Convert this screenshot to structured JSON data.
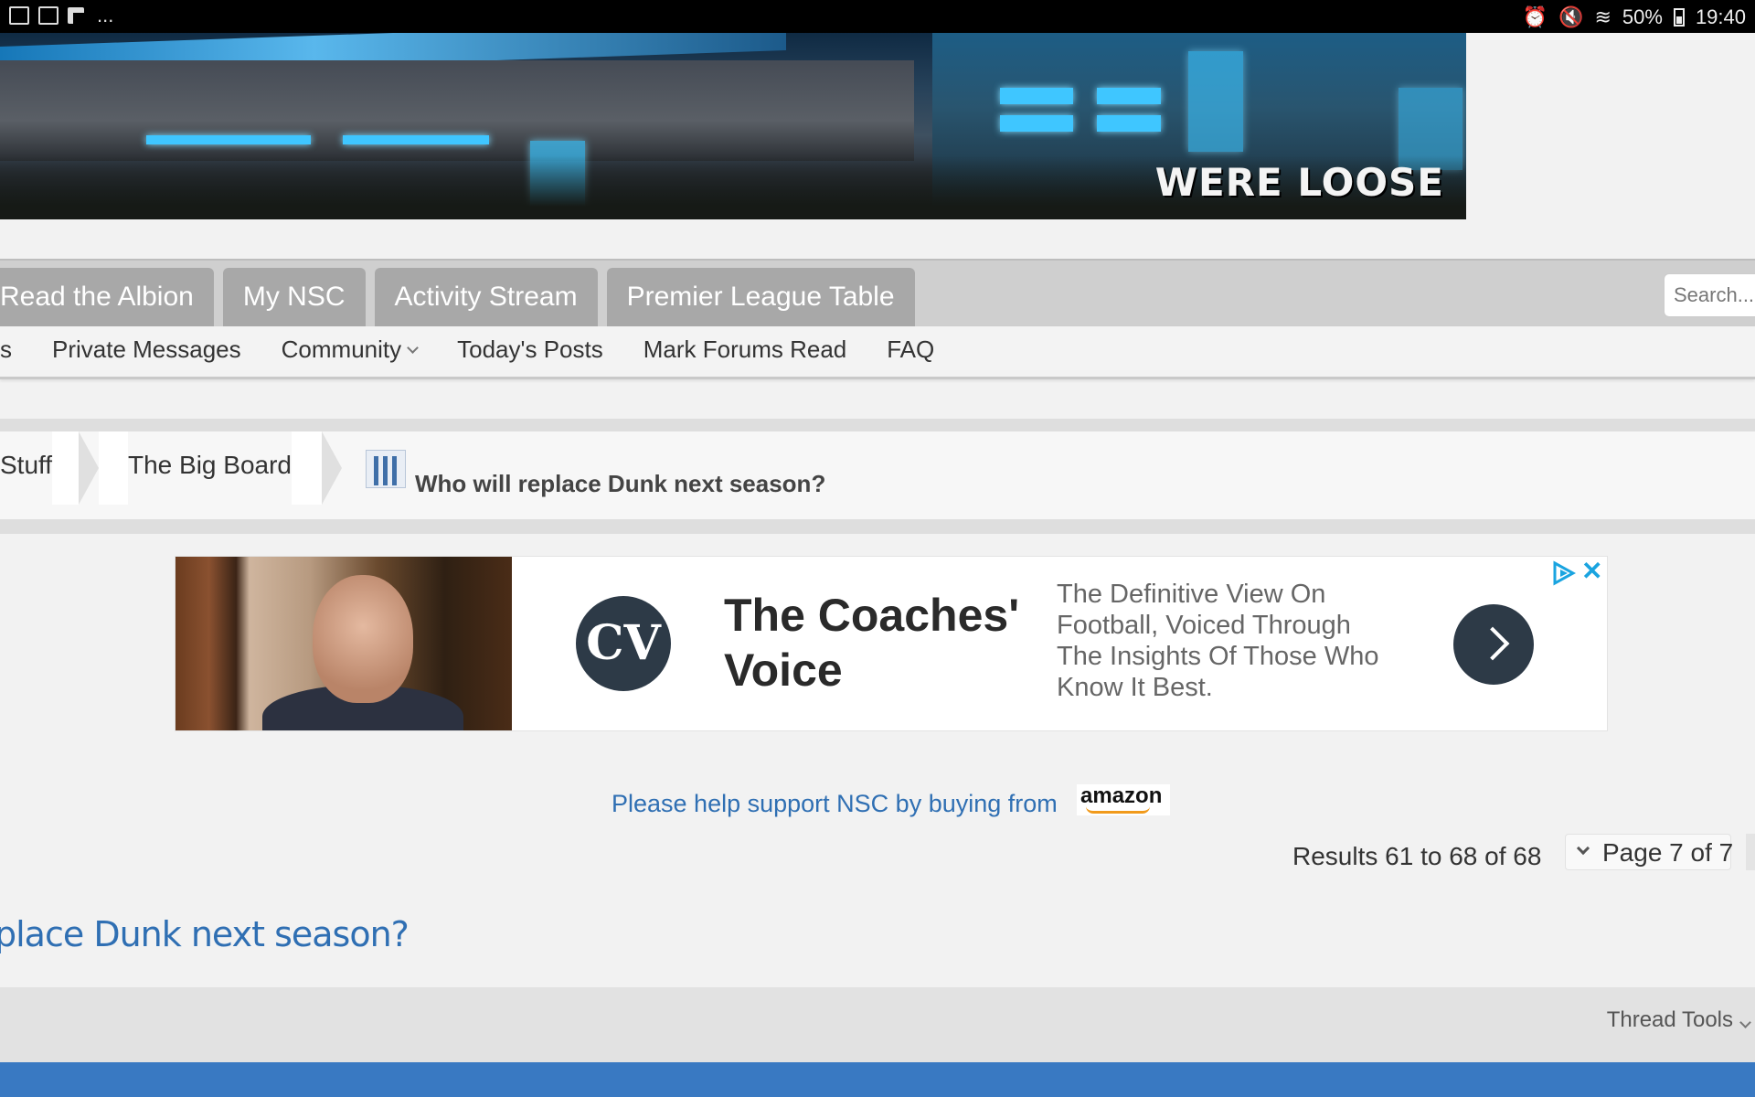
{
  "status_bar": {
    "battery": "50%",
    "time": "19:40",
    "more": "..."
  },
  "banner": {
    "text": "WERE LOOSE"
  },
  "nav": {
    "tabs": [
      "Read the Albion",
      "My NSC",
      "Activity Stream",
      "Premier League Table"
    ],
    "search_placeholder": "Search..."
  },
  "subnav": {
    "items": [
      "s",
      "Private Messages",
      "Community",
      "Today's Posts",
      "Mark Forums Read",
      "FAQ"
    ]
  },
  "breadcrumb": {
    "items": [
      "Stuff",
      "The Big Board"
    ],
    "thread_title": "Who will replace Dunk next season?"
  },
  "ad": {
    "logo_text": "CV",
    "title": "The Coaches' Voice",
    "description": "The Definitive View On Football, Voiced Through The Insights Of Those Who Know It Best."
  },
  "support": {
    "text": "Please help support NSC by buying from",
    "brand": "amazon"
  },
  "pagination": {
    "results": "Results 61 to 68 of 68",
    "page": "Page 7 of 7"
  },
  "thread": {
    "title_partial": "place Dunk next season?"
  },
  "tools": {
    "label": "Thread Tools"
  },
  "colors": {
    "link": "#2f6fb3",
    "tab_bg": "#a8a8a8",
    "footer_bar": "#3979c2"
  }
}
